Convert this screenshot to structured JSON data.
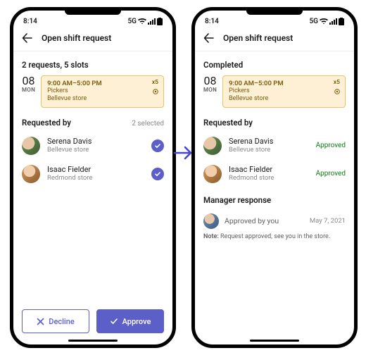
{
  "status": {
    "time": "8:14",
    "network": "5G"
  },
  "appbar": {
    "title": "Open shift request"
  },
  "left": {
    "summary": "2 requests, 5 slots",
    "date_num": "08",
    "date_dow": "MON",
    "slot": {
      "time": "9:00 AM–5:00 PM",
      "role": "Pickers",
      "location": "Bellevue store",
      "count": "x5"
    },
    "requested_by_label": "Requested by",
    "selected_count": "2 selected",
    "people": [
      {
        "name": "Serena Davis",
        "store": "Bellevue store"
      },
      {
        "name": "Isaac Fielder",
        "store": "Redmond store"
      }
    ],
    "decline_label": "Decline",
    "approve_label": "Approve"
  },
  "right": {
    "summary": "Completed",
    "date_num": "08",
    "date_dow": "MON",
    "slot": {
      "time": "9:00 AM–5:00 PM",
      "role": "Pickers",
      "location": "Bellevue store",
      "count": "x5"
    },
    "requested_by_label": "Requested by",
    "approved_label": "Approved",
    "people": [
      {
        "name": "Serena Davis",
        "store": "Bellevue store"
      },
      {
        "name": "Isaac Fielder",
        "store": "Redmond store"
      }
    ],
    "manager_response_label": "Manager response",
    "manager_line": "Approved by you",
    "manager_date": "May 7, 2021",
    "note_label": "Note:",
    "note_text": "Request approved, see you in the store."
  }
}
